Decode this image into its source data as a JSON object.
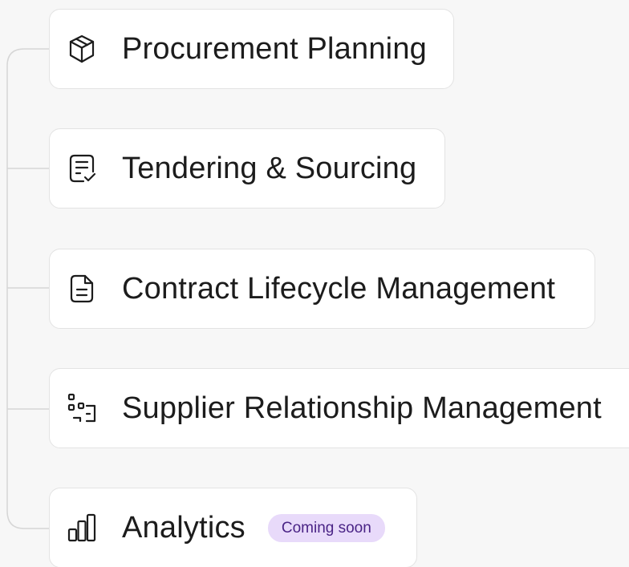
{
  "nav": {
    "items": [
      {
        "label": "Procurement Planning",
        "icon": "package-icon"
      },
      {
        "label": "Tendering & Sourcing",
        "icon": "document-check-icon"
      },
      {
        "label": "Contract Lifecycle Management",
        "icon": "document-icon"
      },
      {
        "label": "Supplier Relationship Management",
        "icon": "network-icon"
      },
      {
        "label": "Analytics",
        "icon": "bar-chart-icon",
        "badge": "Coming soon"
      }
    ]
  },
  "colors": {
    "background": "#f7f7f7",
    "card": "#ffffff",
    "border": "#e3e3e3",
    "connector": "#d6d6d6",
    "badge_bg": "#e8dafa",
    "badge_text": "#4a2486"
  }
}
